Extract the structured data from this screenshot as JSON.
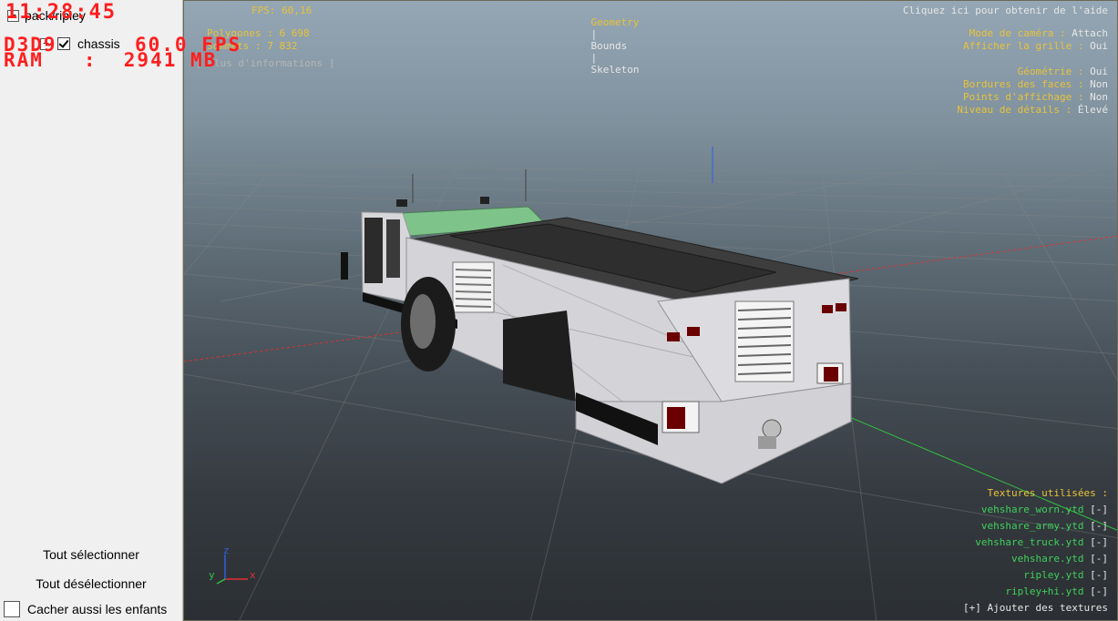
{
  "debug_overlay": {
    "clock": "11:28:45",
    "dbg_label": "D3D9",
    "fps": "60.0 FPS",
    "ram_line": "RAM   :  2941 MB"
  },
  "tree": {
    "root_toggle": "−",
    "root_label": "pack/ripley",
    "child_toggle": "+",
    "child_label": "chassis"
  },
  "left_panel": {
    "select_all": "Tout sélectionner",
    "deselect_all": "Tout désélectionner",
    "hide_children": "Cacher aussi les enfants"
  },
  "viewport": {
    "fps": "FPS: 60,16",
    "modes": {
      "geometry": "Geometry",
      "sep1": "|",
      "bounds": "Bounds",
      "sep2": "|",
      "skeleton": "Skeleton"
    },
    "help": "Cliquez ici pour obtenir de l'aide",
    "stats": {
      "polygons_label": "Polygones :",
      "polygons_value": "6 698",
      "vertices_label": "Sommets :",
      "vertices_value": "7 832",
      "more_info": "[ Plus d'informations ]"
    },
    "settings": [
      {
        "label": "Mode de caméra :",
        "value": "Attach"
      },
      {
        "label": "Afficher la grille :",
        "value": "Oui"
      },
      {
        "label": "",
        "value": ""
      },
      {
        "label": "Géométrie :",
        "value": "Oui"
      },
      {
        "label": "Bordures des faces :",
        "value": "Non"
      },
      {
        "label": "Points d'affichage :",
        "value": "Non"
      },
      {
        "label": "Niveau de détails :",
        "value": "Élevé"
      }
    ],
    "textures": {
      "title": "Textures utilisées :",
      "items": [
        {
          "name": "vehshare_worn.ytd",
          "remove": "[-]"
        },
        {
          "name": "vehshare_army.ytd",
          "remove": "[-]"
        },
        {
          "name": "vehshare_truck.ytd",
          "remove": "[-]"
        },
        {
          "name": "vehshare.ytd",
          "remove": "[-]"
        },
        {
          "name": "ripley.ytd",
          "remove": "[-]"
        },
        {
          "name": "ripley+hi.ytd",
          "remove": "[-]"
        }
      ],
      "add": "[+] Ajouter des textures"
    },
    "axis": {
      "x": "x",
      "y": "y",
      "z": "z"
    }
  },
  "colors": {
    "accent_yellow": "#e8c23a",
    "texture_green": "#3fcf5a",
    "debug_red": "#ff1e1e",
    "axis_x": "#e03030",
    "axis_y": "#30c040",
    "axis_z": "#3060e0"
  }
}
